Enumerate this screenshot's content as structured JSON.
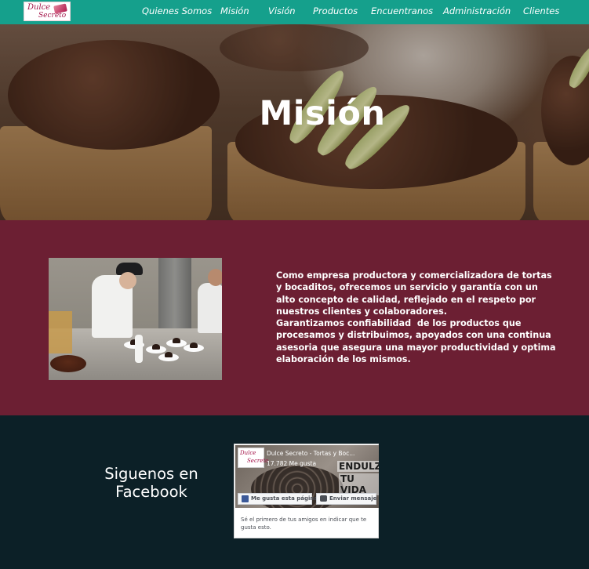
{
  "brand": {
    "logo_line1": "Dulce",
    "logo_line2": "Secreto"
  },
  "nav": {
    "items": [
      {
        "label": "Quienes Somos"
      },
      {
        "label": "Misión"
      },
      {
        "label": "Visión"
      },
      {
        "label": "Productos"
      },
      {
        "label": "Encuentranos"
      },
      {
        "label": "Administración"
      },
      {
        "label": "Clientes"
      }
    ]
  },
  "hero": {
    "title": "Misión"
  },
  "mission": {
    "paragraph_1": "Como empresa productora y comercializadora de tortas y bocaditos, ofrecemos un servicio y garantía con un alto concepto de calidad, reflejado en el respeto por nuestros clientes y colaboradores.",
    "paragraph_2": "Garantizamos confiabilidad  de los productos que procesamos y distribuimos, apoyados con una continua asesoria que asegura una mayor productividad y optima elaboración de los mismos."
  },
  "social": {
    "title": "Siguenos en Facebook",
    "facebook": {
      "page_name": "Dulce Secreto - Tortas y Boc...",
      "likes": "17.782 Me gusta",
      "cover_text_1": "ENDULZA",
      "cover_text_2": "TU VIDA",
      "like_button": "Me gusta esta página",
      "message_button": "Enviar mensaje",
      "friends_text": "Sé el primero de tus amigos en indicar que te gusta esto."
    }
  },
  "colors": {
    "navbar": "#15a08c",
    "mission_bg": "#6c1f33",
    "social_bg": "#0c2027",
    "facebook_blue": "#3b5998"
  }
}
